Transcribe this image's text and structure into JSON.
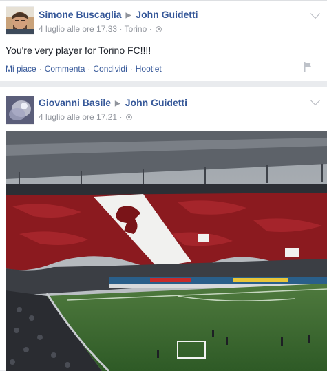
{
  "posts": [
    {
      "author": "Simone Buscaglia",
      "target": "John Guidetti",
      "timestamp": "4 luglio alle ore 17.33",
      "location": "Torino",
      "text": "You're very player for Torino FC!!!!",
      "actions": [
        "Mi piace",
        "Commenta",
        "Condividi",
        "Hootlet"
      ]
    },
    {
      "author": "Giovanni Basile",
      "target": "John Guidetti",
      "timestamp": "4 luglio alle ore 17.21"
    }
  ],
  "icons": {
    "separator": "triangle-right-icon",
    "privacy": "globe-icon",
    "options": "chevron-down-icon",
    "report": "flag-icon"
  },
  "colors": {
    "link": "#365899",
    "meta": "#90949c",
    "text": "#1d2129",
    "feed_bg": "#e9ebee",
    "torino_granata": "#8b1a1f"
  }
}
